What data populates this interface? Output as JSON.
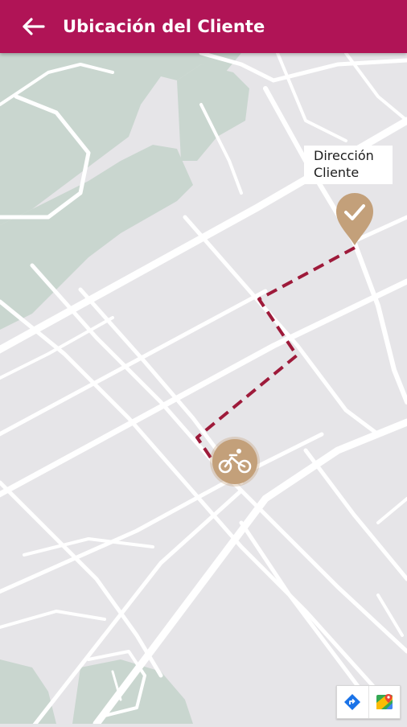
{
  "app_bar": {
    "title": "Ubicación del Cliente",
    "background": "#b01456",
    "back_icon": "arrow-back-icon"
  },
  "map": {
    "destination_label": "Dirección\nCliente",
    "destination_marker_icon": "check-icon",
    "courier_marker_icon": "bicycle-icon",
    "route_color": "#9e1a3a",
    "marker_color": "#c3a07a",
    "park_color": "#c9d6cf",
    "directions_button_icon": "directions-icon",
    "open_maps_button_icon": "google-maps-icon"
  }
}
